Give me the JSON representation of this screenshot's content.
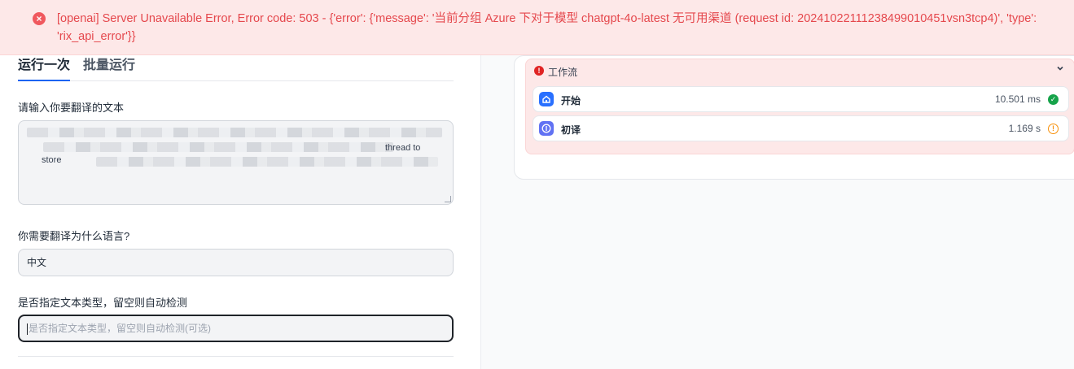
{
  "error": {
    "icon": "close-circle-icon",
    "message": "[openai] Server Unavailable Error, Error code: 503 - {'error': {'message': '当前分组 Azure 下对于模型 chatgpt-4o-latest 无可用渠道 (request id: 20241022111238499010451vsn3tcp4)', 'type': 'rix_api_error'}}"
  },
  "tabs": {
    "run_once": "运行一次",
    "batch_run": "批量运行"
  },
  "form": {
    "text_label": "请输入你要翻译的文本",
    "text_fragment_1": "thread to",
    "text_fragment_2": "store",
    "language_label": "你需要翻译为什么语言?",
    "language_value": "中文",
    "type_label": "是否指定文本类型，留空则自动检测",
    "type_placeholder": "是否指定文本类型，留空则自动检测(可选)"
  },
  "workflow": {
    "title": "工作流",
    "status": "error",
    "nodes": [
      {
        "name": "开始",
        "time": "10.501 ms",
        "icon": "home-icon",
        "status": "success"
      },
      {
        "name": "初译",
        "time": "1.169 s",
        "icon": "compass-icon",
        "status": "warning"
      }
    ]
  },
  "colors": {
    "error_bg": "#fde8e8",
    "error_text": "#e5484d",
    "accent": "#1c64f2",
    "success": "#16a34a",
    "warning": "#f79009"
  }
}
